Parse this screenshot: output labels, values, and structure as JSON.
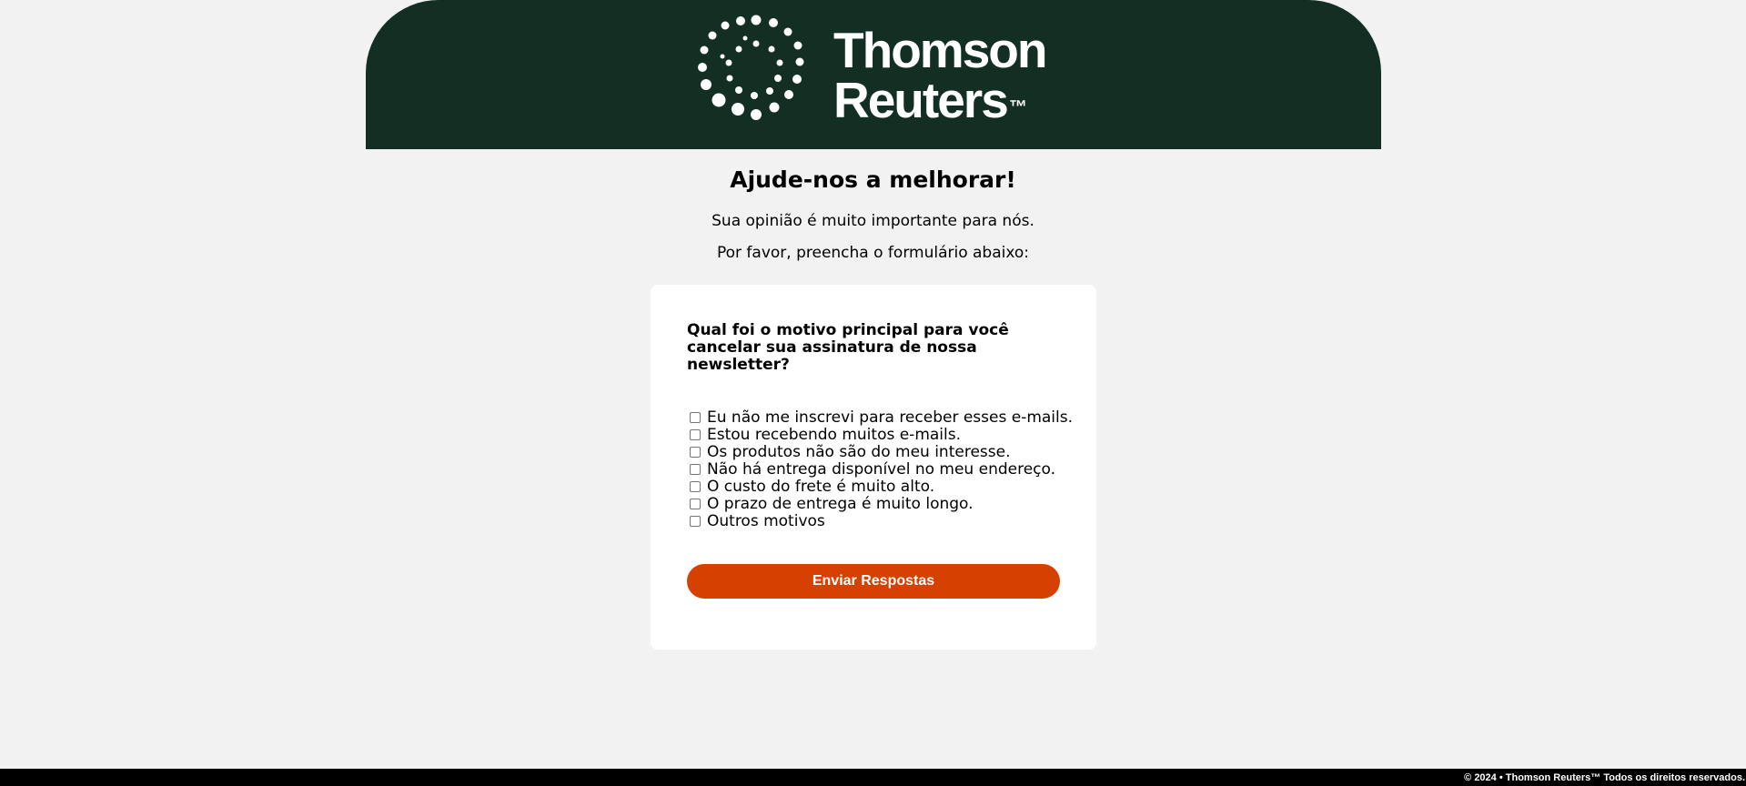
{
  "header": {
    "logo": {
      "line1": "Thomson",
      "line2": "Reuters",
      "trademark": "™",
      "icon": "dot-ring-icon",
      "background_color": "#132f23",
      "text_color": "#ffffff"
    }
  },
  "main": {
    "title": "Ajude-nos a melhorar!",
    "subtitle1": "Sua opinião é muito importante para nós.",
    "subtitle2": "Por favor, preencha o formulário abaixo:"
  },
  "form": {
    "question": "Qual foi o motivo principal para você cancelar sua assinatura de nossa newsletter?",
    "options": [
      {
        "label": "Eu não me inscrevi para receber esses e-mails.",
        "checked": false
      },
      {
        "label": "Estou recebendo muitos e-mails.",
        "checked": false
      },
      {
        "label": "Os produtos não são do meu interesse.",
        "checked": false
      },
      {
        "label": "Não há entrega disponível no meu endereço.",
        "checked": false
      },
      {
        "label": "O custo do frete é muito alto.",
        "checked": false
      },
      {
        "label": "O prazo de entrega é muito longo.",
        "checked": false
      },
      {
        "label": "Outros motivos",
        "checked": false
      }
    ],
    "submit_label": "Enviar Respostas",
    "submit_color": "#d64000"
  },
  "footer": {
    "text": "© 2024 • Thomson Reuters™ Todos os direitos reservados."
  }
}
